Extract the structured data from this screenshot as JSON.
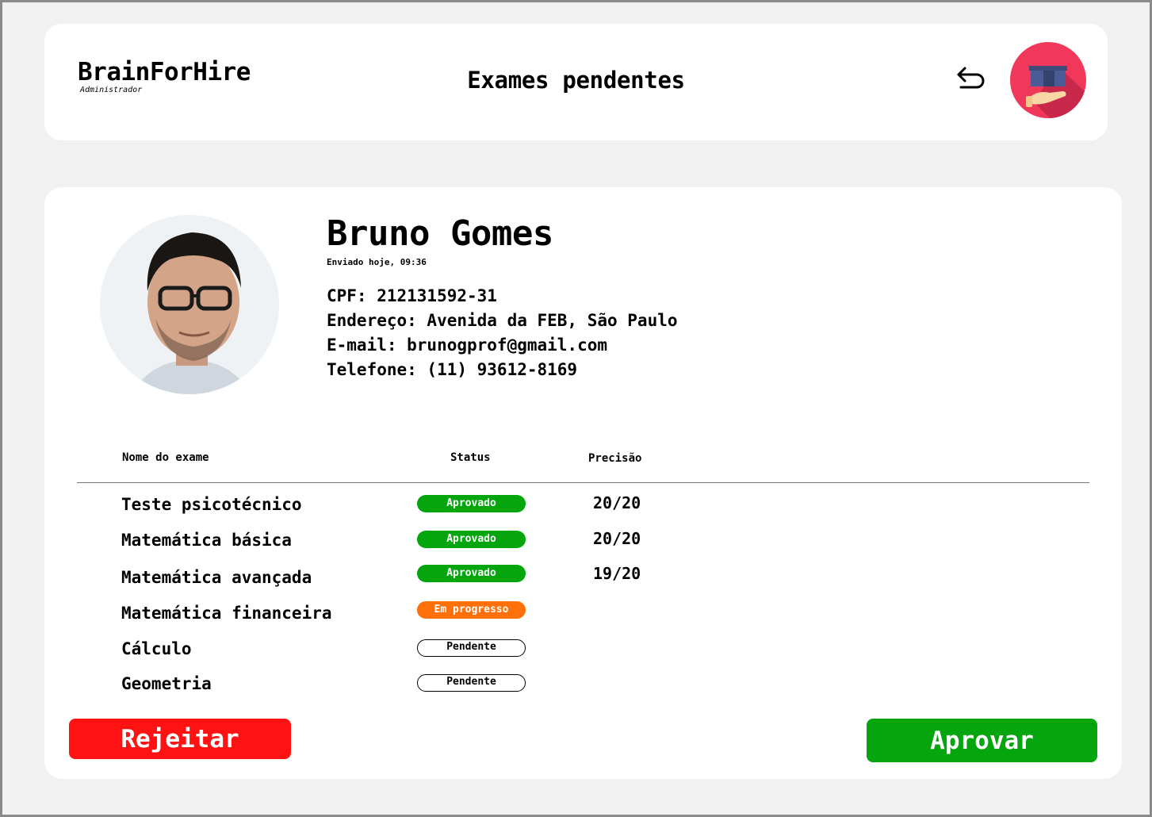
{
  "header": {
    "brand_name": "BrainForHire",
    "brand_role": "Administrador",
    "page_title": "Exames pendentes",
    "back_icon": "undo-arrow-icon",
    "logo_icon": "graduation-cap-hand-logo"
  },
  "candidate": {
    "name": "Bruno Gomes",
    "sent": "Enviado hoje, 09:36",
    "details": [
      "CPF: 212131592-31",
      "Endereço: Avenida da FEB, São Paulo",
      "E-mail: brunogprof@gmail.com",
      "Telefone: (11) 93612-8169"
    ]
  },
  "table": {
    "headers": {
      "name": "Nome do exame",
      "status": "Status",
      "precision": "Precisão"
    },
    "rows": [
      {
        "name": "Teste psicotécnico",
        "status": "Aprovado",
        "status_type": "approved",
        "score": "20/20"
      },
      {
        "name": "Matemática básica",
        "status": "Aprovado",
        "status_type": "approved",
        "score": "20/20"
      },
      {
        "name": "Matemática avançada",
        "status": "Aprovado",
        "status_type": "approved",
        "score": "19/20"
      },
      {
        "name": "Matemática financeira",
        "status": "Em progresso",
        "status_type": "in-progress",
        "score": ""
      },
      {
        "name": "Cálculo",
        "status": "Pendente",
        "status_type": "pending",
        "score": ""
      },
      {
        "name": "Geometria",
        "status": "Pendente",
        "status_type": "pending",
        "score": ""
      }
    ]
  },
  "actions": {
    "reject": "Rejeitar",
    "approve": "Aprovar"
  },
  "colors": {
    "approved": "#05a50d",
    "in_progress": "#ff6f0a",
    "reject": "#ff1212",
    "logo_bg": "#f2385a"
  }
}
